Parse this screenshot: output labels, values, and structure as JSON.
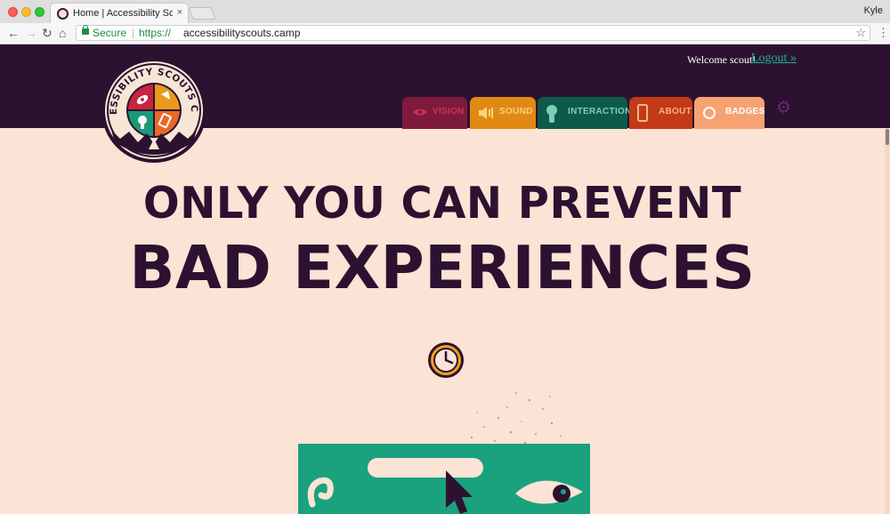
{
  "browser": {
    "tab_title": "Home | Accessibility Scouts Ca",
    "tab_close": "×",
    "profile_name": "Kyle",
    "nav": {
      "back": "←",
      "forward": "→",
      "reload": "↻",
      "home": "⌂"
    },
    "secure_label": "Secure",
    "url_scheme": "https://",
    "url_host": "accessibilityscouts.camp",
    "star": "☆",
    "menu": "⋮"
  },
  "site": {
    "logo_text": "ACCESSIBILITY SCOUTS CAMP",
    "welcome_text": "Welcome scout!",
    "logout_label": "Logout »",
    "nav_tabs": [
      {
        "label": "VISION",
        "icon": "eye-icon",
        "color": "#7e1a3c"
      },
      {
        "label": "SOUND",
        "icon": "speaker-icon",
        "color": "#e08a13"
      },
      {
        "label": "INTERACTION",
        "icon": "pointer-icon",
        "color": "#0e5a4a"
      },
      {
        "label": "ABOUT",
        "icon": "phone-icon",
        "color": "#c23a16"
      },
      {
        "label": "BADGES",
        "icon": "badge-circle-icon",
        "color": "#f6a273"
      }
    ],
    "settings_icon": "⚙",
    "colors": {
      "header_bg": "#2c1230",
      "page_bg": "#fbe3d5",
      "link": "#1bb58c",
      "heading": "#2c1230"
    }
  },
  "hero": {
    "line1": "ONLY YOU CAN PREVENT",
    "line2": "BAD EXPERIENCES"
  }
}
